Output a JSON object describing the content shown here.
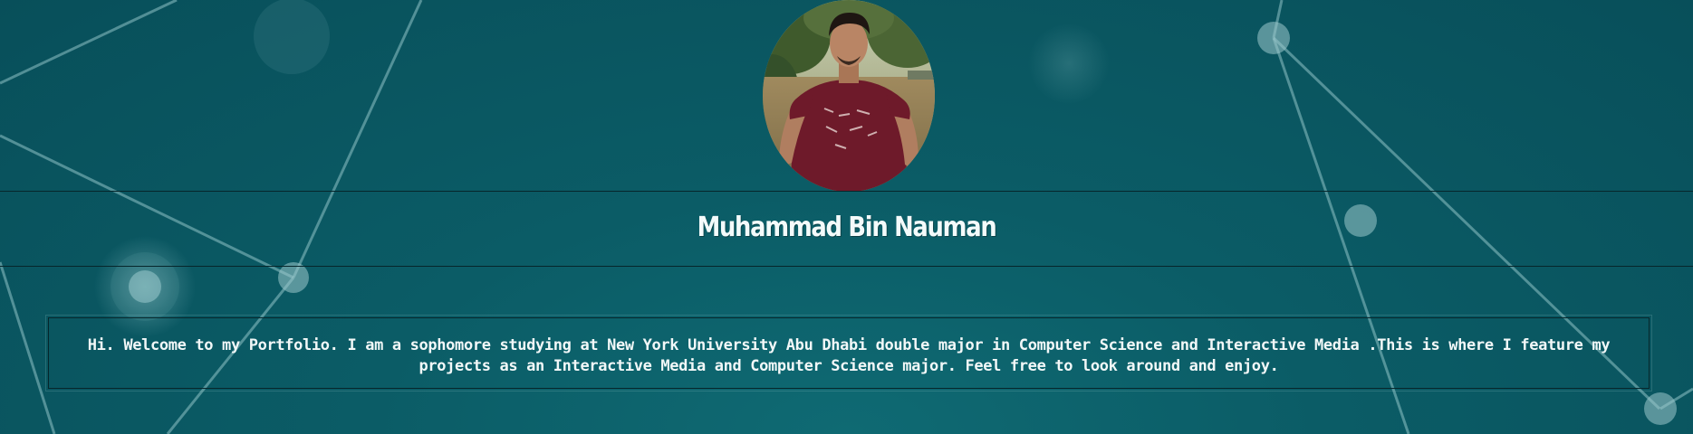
{
  "profile": {
    "name": "Muhammad Bin Nauman",
    "photo_icon": "profile-photo"
  },
  "intro": {
    "text": "Hi. Welcome to my Portfolio. I am a sophomore studying at New York University Abu Dhabi double major in Computer Science and Interactive Media .This is where I feature my projects as an Interactive Media and Computer Science major. Feel free to look around and enjoy."
  },
  "colors": {
    "background": "#0b5c66",
    "text": "#f2f8f8",
    "rule": "#06262b"
  }
}
